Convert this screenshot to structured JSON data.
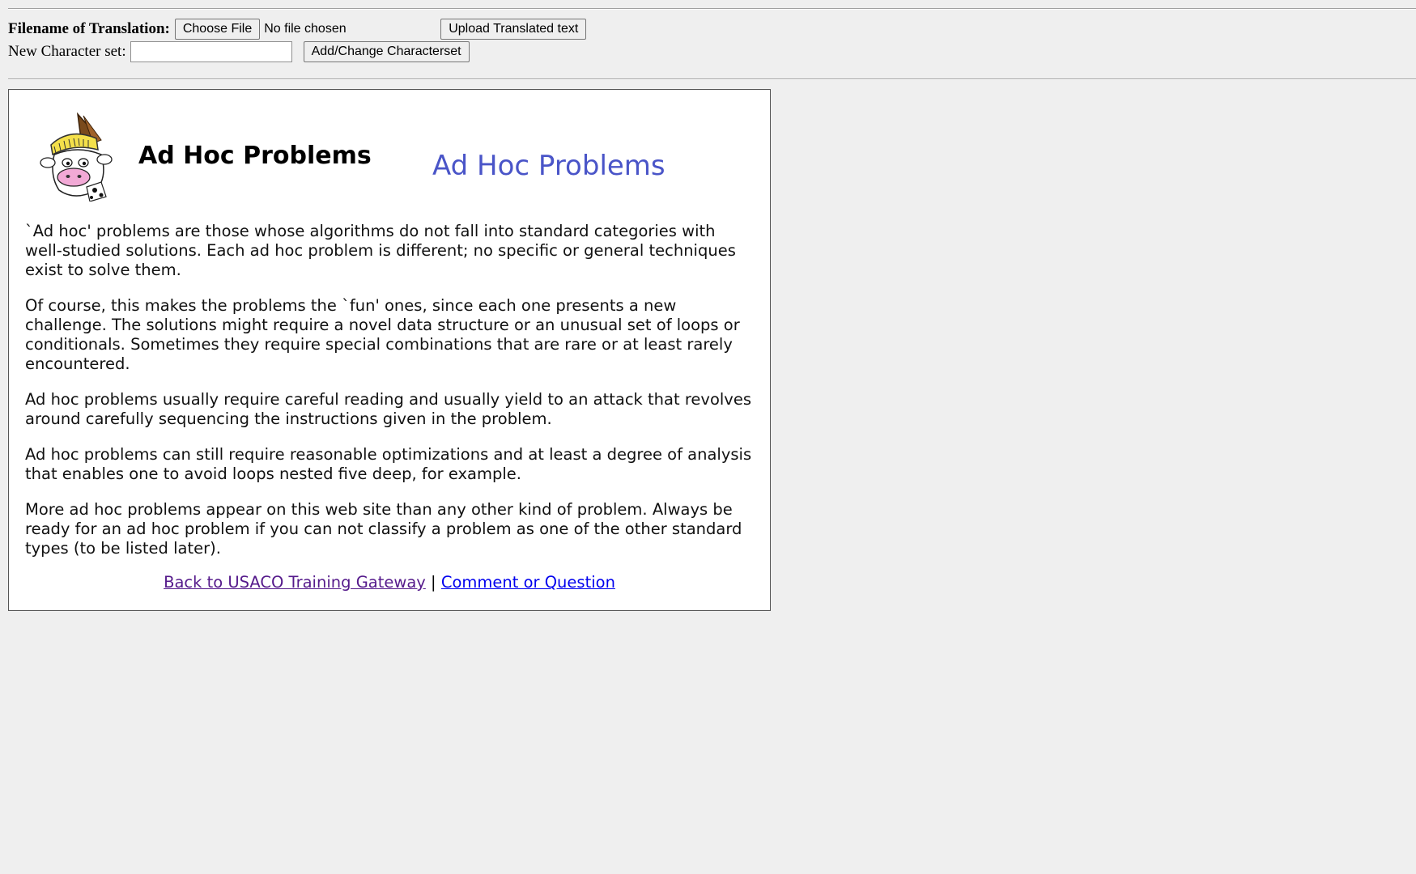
{
  "upload_form": {
    "filename_label": "Filename of Translation:",
    "choose_file_label": "Choose File",
    "file_status": "No file chosen",
    "upload_button_label": "Upload Translated text",
    "charset_label": "New Character set:",
    "charset_value": "",
    "charset_button_label": "Add/Change Characterset"
  },
  "article": {
    "title": "Ad Hoc Problems",
    "title_image_text": "Ad Hoc Problems",
    "paragraphs": [
      "`Ad hoc' problems are those whose algorithms do not fall into standard categories with well-studied solutions. Each ad hoc problem is different; no specific or general techniques exist to solve them.",
      "Of course, this makes the problems the `fun' ones, since each one presents a new challenge. The solutions might require a novel data structure or an unusual set of loops or conditionals. Sometimes they require special combinations that are rare or at least rarely encountered.",
      "Ad hoc problems usually require careful reading and usually yield to an attack that revolves around carefully sequencing the instructions given in the problem.",
      "Ad hoc problems can still require reasonable optimizations and at least a degree of analysis that enables one to avoid loops nested five deep, for example.",
      "More ad hoc problems appear on this web site than any other kind of problem. Always be ready for an ad hoc problem if you can not classify a problem as one of the other standard types (to be listed later)."
    ],
    "footer": {
      "back_link": "Back to USACO Training Gateway",
      "separator": "|",
      "comment_link": "Comment or Question"
    }
  },
  "colors": {
    "page_background": "#efefef",
    "title_image_blue": "#4a55c8",
    "visited_link": "#551a8b",
    "link": "#0000ee"
  },
  "icons": {
    "logo": "cow-knight-mascot-icon"
  }
}
